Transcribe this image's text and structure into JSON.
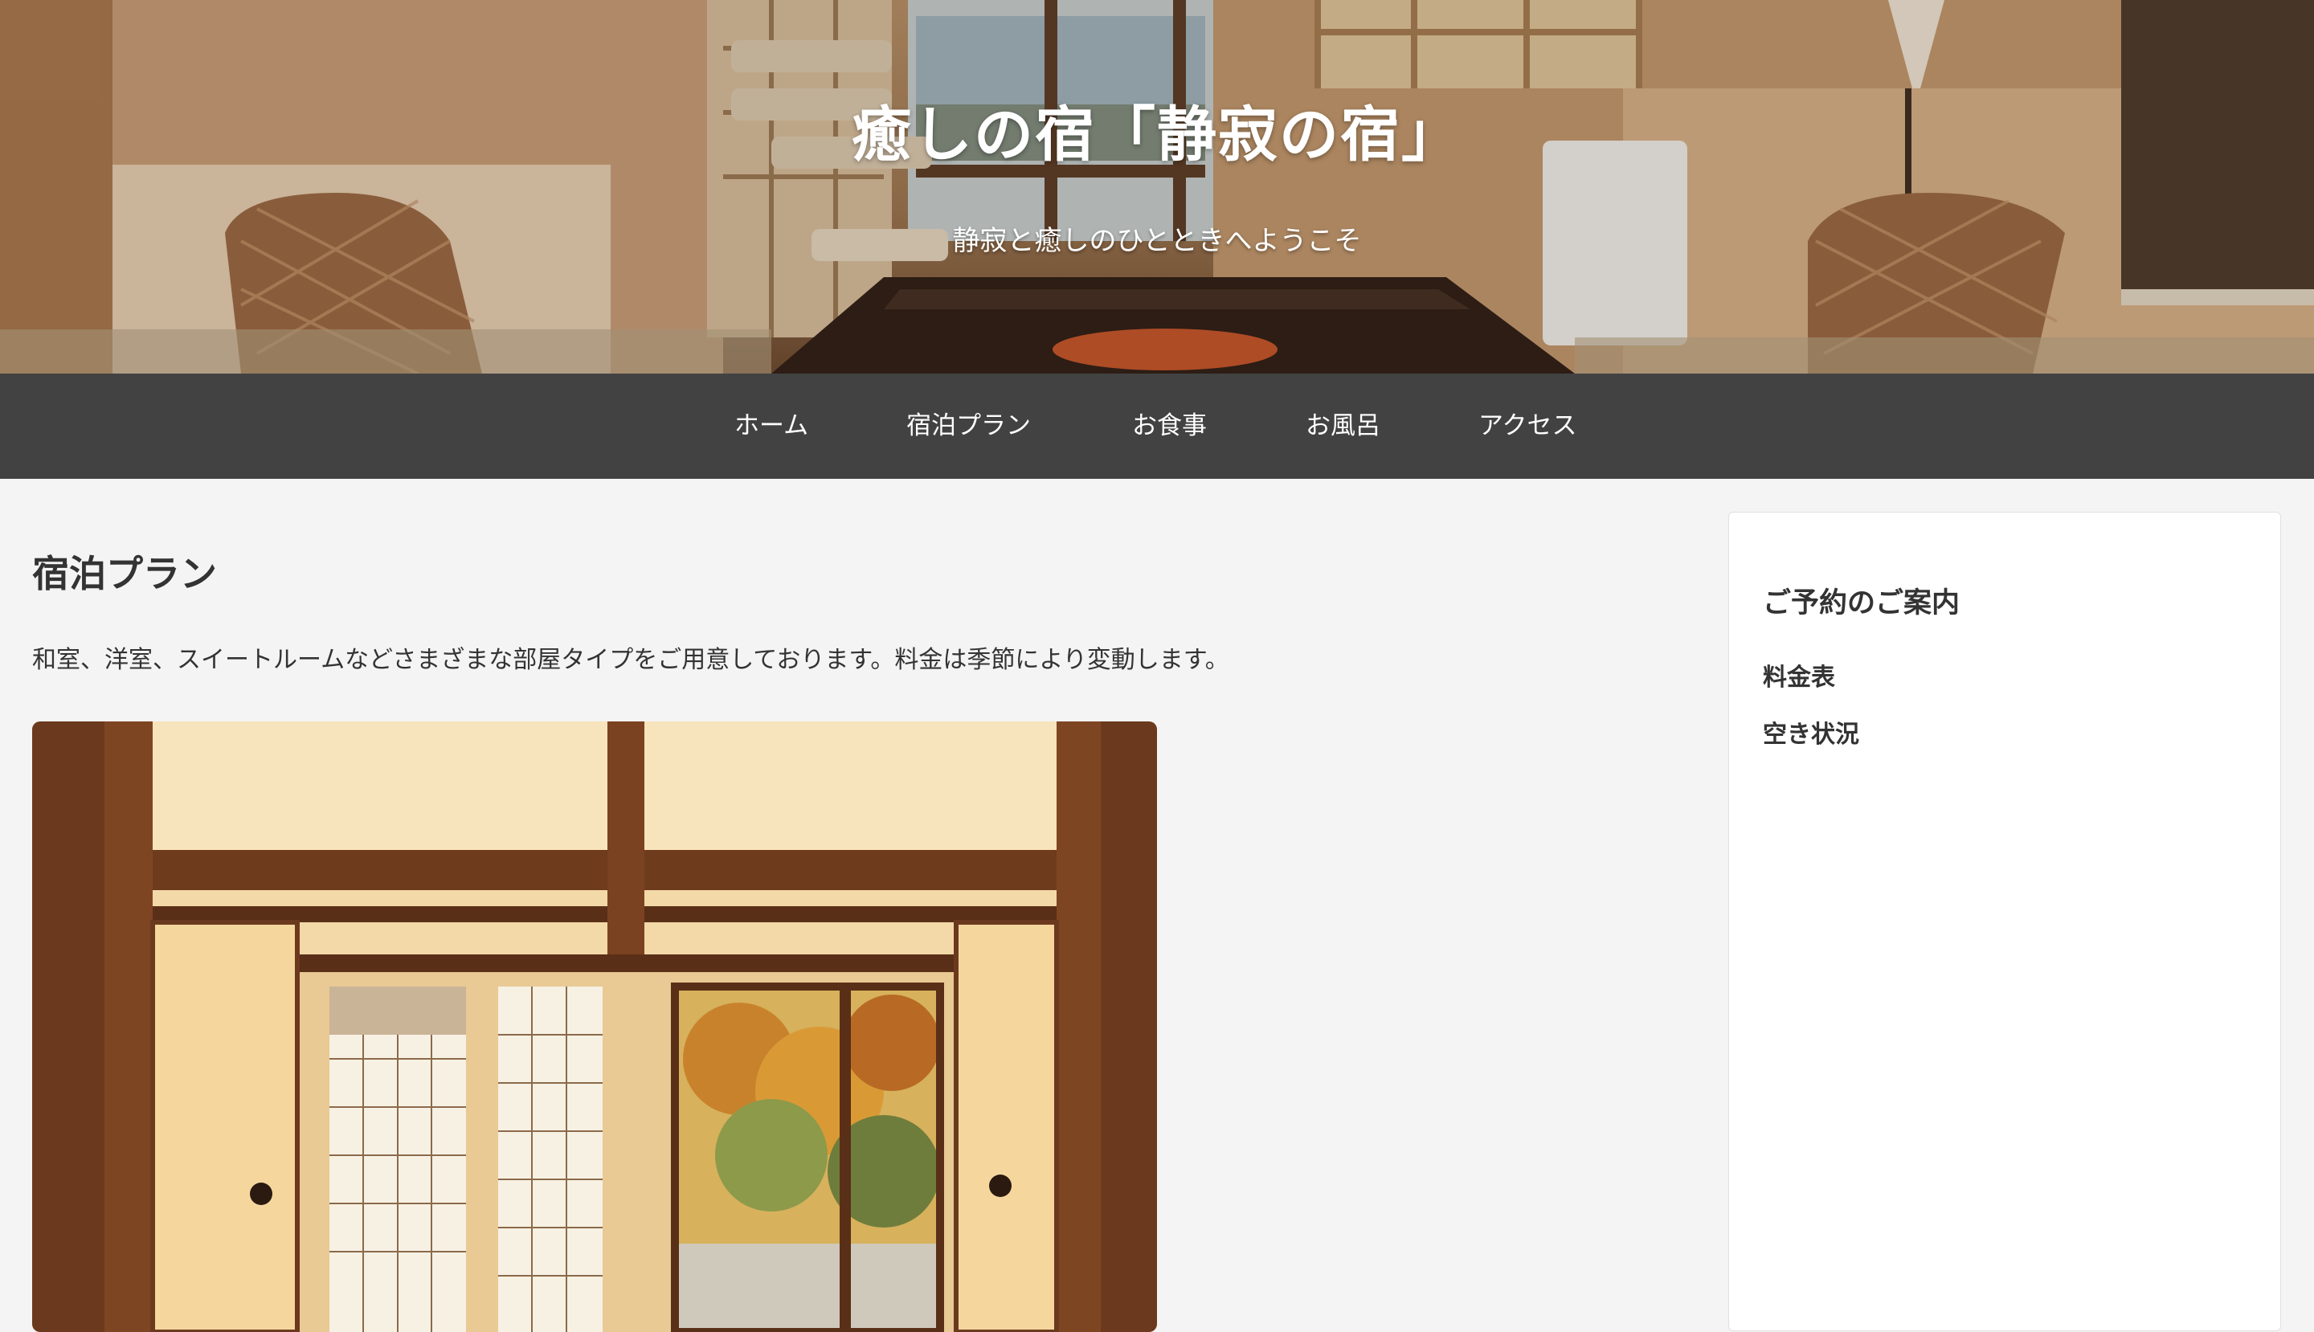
{
  "header": {
    "site_title": "癒しの宿「静寂の宿」",
    "tagline": "静寂と癒しのひとときへようこそ",
    "image": "hero-japanese-room-image"
  },
  "nav": {
    "items": [
      {
        "label": "ホーム"
      },
      {
        "label": "宿泊プラン"
      },
      {
        "label": "お食事"
      },
      {
        "label": "お風呂"
      },
      {
        "label": "アクセス"
      }
    ]
  },
  "main": {
    "title": "宿泊プラン",
    "intro": "和室、洋室、スイートルームなどさまざまな部屋タイプをご用意しております。料金は季節により変動します。",
    "image": "tatami-room-photo"
  },
  "sidebar": {
    "heading": "ご予約のご案内",
    "links": [
      {
        "label": "料金表"
      },
      {
        "label": "空き状況"
      }
    ]
  },
  "colors": {
    "nav_background": "#424242",
    "page_background": "#f4f4f4",
    "text": "#333333",
    "header_text": "#ffffff"
  }
}
